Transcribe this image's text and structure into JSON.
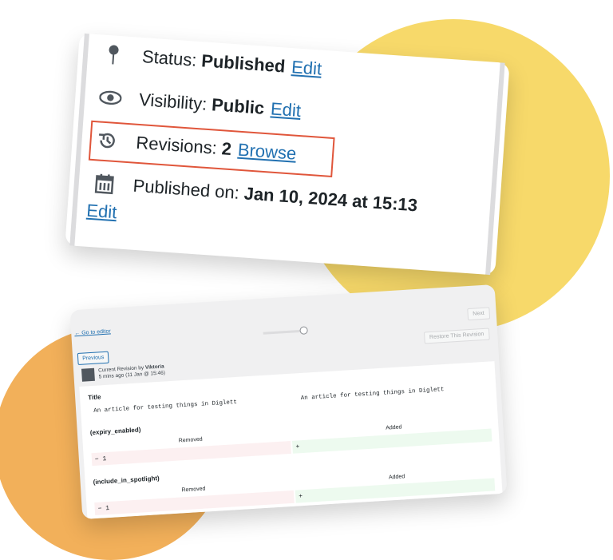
{
  "status": {
    "label": "Status:",
    "value": "Published",
    "action": "Edit"
  },
  "visibility": {
    "label": "Visibility:",
    "value": "Public",
    "action": "Edit"
  },
  "revisions": {
    "label": "Revisions:",
    "value": "2",
    "action": "Browse"
  },
  "published": {
    "label": "Published on:",
    "value": "Jan 10, 2024 at 15:13",
    "action": "Edit"
  },
  "revision_ui": {
    "go_to_editor": "← Go to editor",
    "next": "Next",
    "previous": "Previous",
    "restore": "Restore This Revision",
    "current_revision": "Current Revision by",
    "author": "Viktoria",
    "time": "5 mins ago (11 Jan @ 15:46)",
    "fields": {
      "title": {
        "name": "Title",
        "left": "An article for testing things in Diglett",
        "right": "An article for testing things in Diglett"
      },
      "expiry": {
        "name": "(expiry_enabled)",
        "removed": "Removed",
        "added": "Added",
        "minus": "− 1",
        "plus": "+"
      },
      "spotlight": {
        "name": "(include_in_spotlight)",
        "removed": "Removed",
        "added": "Added",
        "minus": "− 1",
        "plus": "+"
      }
    }
  },
  "colors": {
    "yellow": "#f7d96a",
    "orange": "#f2b05a",
    "link": "#2271b1",
    "highlight": "#e0563b"
  },
  "icons": [
    "pin-icon",
    "eye-icon",
    "history-icon",
    "calendar-icon"
  ]
}
